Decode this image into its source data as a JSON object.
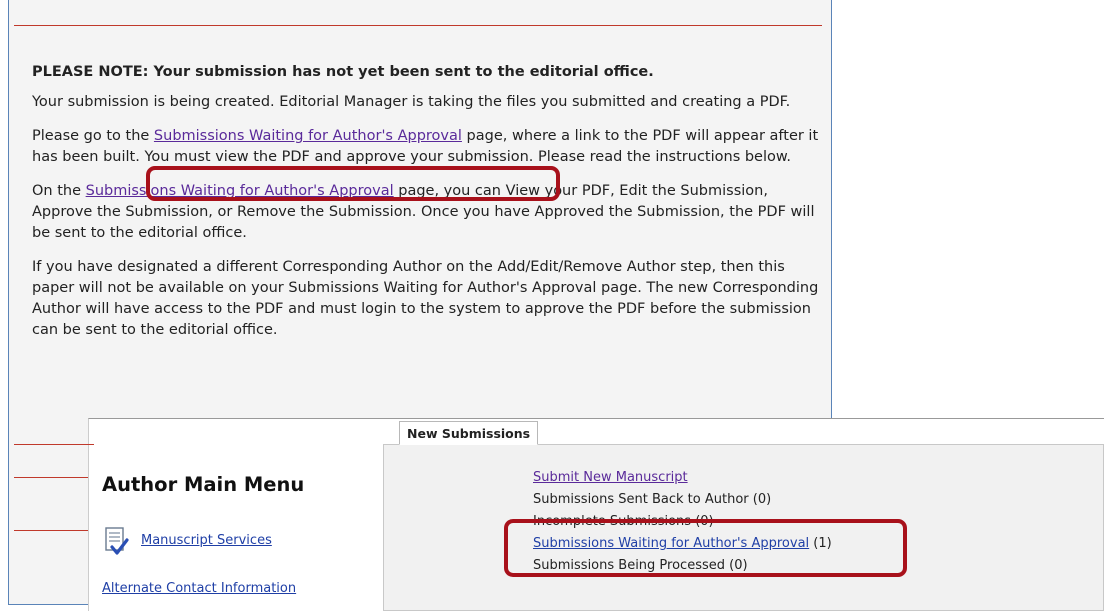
{
  "notice": {
    "heading": "PLEASE NOTE: Your submission has not yet been sent to the editorial office.",
    "p1": "Your submission is being created. Editorial Manager is taking the files you submitted and creating a PDF.",
    "p2_before": "Please go to the ",
    "p2_link": "Submissions Waiting for Author's Approval",
    "p2_after": " page, where a link to the PDF will appear after it has been built. You must view the PDF and approve your submission. Please read the instructions below.",
    "p3_before": "On the ",
    "p3_link": "Submissions Waiting for Author's Approval",
    "p3_after": " page, you can View your PDF, Edit the Submission, Approve the Submission, or Remove the Submission. Once you have Approved the Submission, the PDF will be sent to the editorial office.",
    "p4": "If you have designated a different Corresponding Author on the Add/Edit/Remove Author step, then this paper will not be available on your Submissions Waiting for Author's Approval page. The new Corresponding Author will have access to the PDF and must login to the system to approve the PDF before the submission can be sent to the editorial office."
  },
  "menu": {
    "title": "Author Main Menu",
    "manuscript_services": "Manuscript Services",
    "alternate_contact": "Alternate Contact Information"
  },
  "new_submissions": {
    "tab_label": "New Submissions",
    "submit_new": "Submit New Manuscript",
    "sent_back": "Submissions Sent Back to Author (0)",
    "incomplete": "Incomplete Submissions (0)",
    "waiting_link": "Submissions Waiting for Author's Approval",
    "waiting_count": " (1)",
    "being_processed": "Submissions Being Processed (0)"
  },
  "colors": {
    "highlight": "#a8111b",
    "visited_link": "#5a2a9a",
    "link": "#1f3fa6",
    "rule": "#c0392b"
  }
}
